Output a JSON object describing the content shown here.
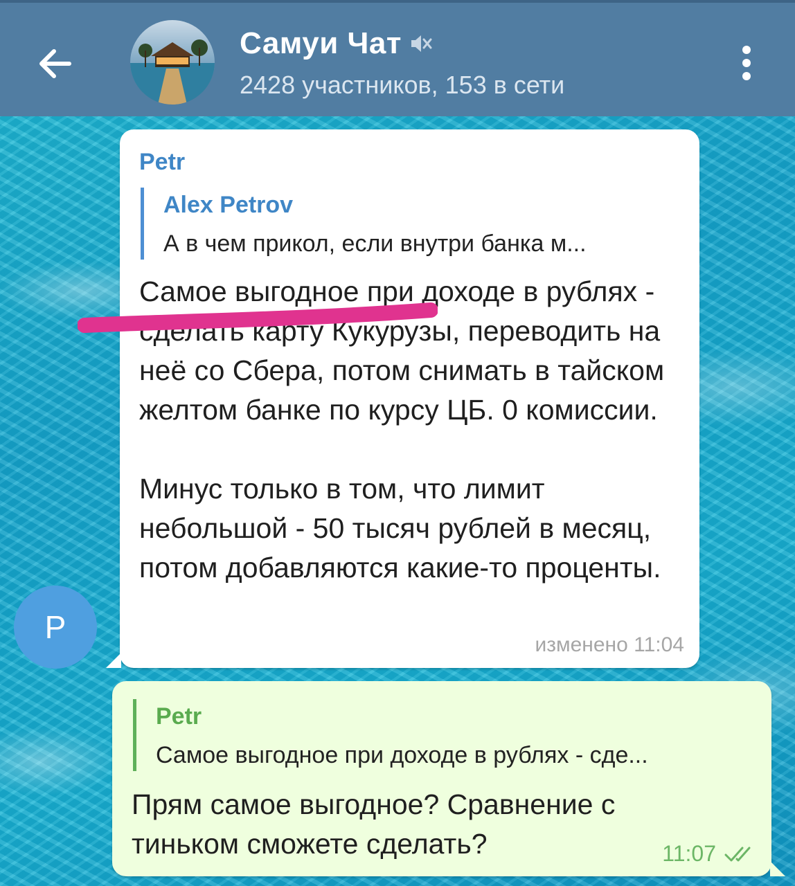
{
  "header": {
    "title": "Самуи Чат",
    "subtitle": "2428 участников, 153 в сети",
    "back_icon": "arrow-left-icon",
    "mute_icon": "muted-speaker-icon",
    "menu_icon": "vertical-dots-icon"
  },
  "messages": [
    {
      "sender": "Petr",
      "reply": {
        "name": "Alex Petrov",
        "text": "А в чем прикол, если внутри банка м..."
      },
      "text": "Самое выгодное при доходе в рублях - сделать карту Кукурузы, переводить на неё со Сбера, потом снимать в тайском желтом банке по курсу ЦБ. 0 комиссии.\n\nМинус только в том, что лимит небольшой - 50 тысяч рублей в месяц, потом добавляются какие-то проценты.",
      "meta": "изменено 11:04",
      "avatar_initial": "P"
    },
    {
      "outgoing": true,
      "reply": {
        "name": "Petr",
        "text": "Самое выгодное при доходе в рублях - сде..."
      },
      "text": "Прям самое выгодное? Сравнение с тиньком сможете сделать?",
      "time": "11:07",
      "status_icon": "double-check-icon"
    }
  ],
  "colors": {
    "header": "#517da2",
    "incoming_name": "#3f86c6",
    "outgoing_bubble": "#efffde",
    "outgoing_accent": "#5fb05a",
    "highlight_stroke": "#e0338f"
  }
}
